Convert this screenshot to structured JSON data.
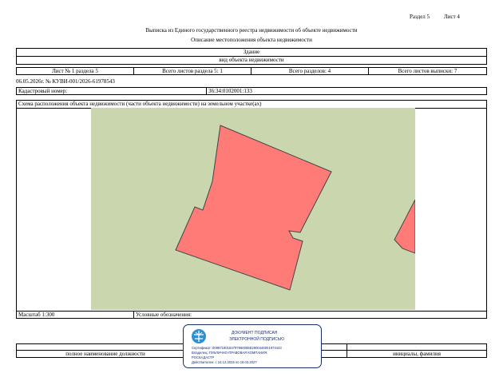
{
  "header": {
    "section": "Раздел 5",
    "sheet": "Лист 4",
    "title": "Выписка из Единого государственного реестра недвижимости об объекте недвижимости",
    "subtitle": "Описание местоположения объекта недвижимости"
  },
  "object": {
    "type": "Здание",
    "type_caption": "вид объекта недвижимости"
  },
  "sheets_row": {
    "sheet_of_section": "Лист № 1 раздела 5",
    "section_sheets": "Всего листов раздела 5: 1",
    "sections_total": "Всего разделов: 4",
    "extract_sheets": "Всего листов выписки: 7"
  },
  "document_ref": "06.05.2026г. № КУВИ-001/2026-61978543",
  "cadastral": {
    "label": "Кадастровый номер:",
    "value": "36:34:0102001:133"
  },
  "scheme": {
    "title": "Схема расположения объекта недвижимости (части объекта недвижимости) на земельном участке(ах)",
    "colors": {
      "land": "#c9d6ae",
      "building": "#ff7b78",
      "outline": "#444444"
    }
  },
  "scale_row": {
    "scale": "Масштаб 1:300",
    "legend": "Условные обозначения:"
  },
  "signature": {
    "position_caption": "полное наименование должности",
    "name_caption": "инициалы, фамилия"
  },
  "stamp": {
    "line1": "ДОКУМЕНТ ПОДПИСАН",
    "line2": "ЭЛЕКТРОННОЙ ПОДПИСЬЮ",
    "cert": "Сертификат: 00997180184797860065E2900446001974443",
    "owner": "Владелец: ПУБЛИЧНО-ПРАВОВАЯ КОМПАНИЯ",
    "owner2": "РОСКАДАСТР",
    "valid": "Действителен: с 24.12.2025 по 19.03.2027",
    "icon": "rosreestr-emblem-icon"
  }
}
